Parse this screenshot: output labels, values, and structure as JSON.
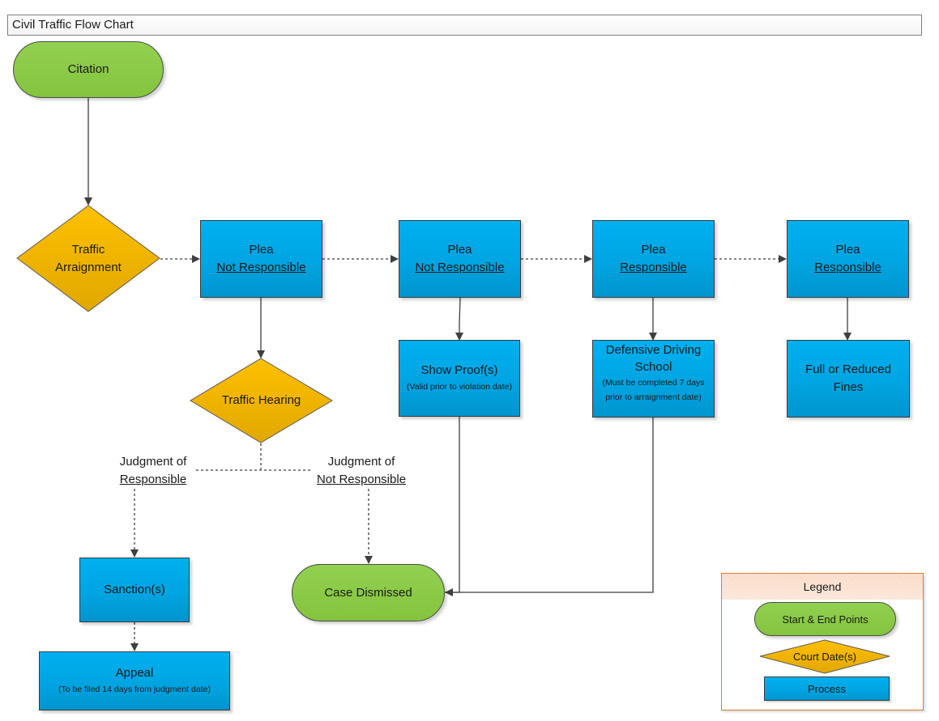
{
  "title": "Civil Traffic Flow Chart",
  "colors": {
    "terminal": "#92d050",
    "decision": "#f5b800",
    "process": "#00b0f0",
    "legend_border": "#e07b39",
    "connector": "#3f3f3f"
  },
  "nodes": {
    "citation": {
      "label": "Citation",
      "type": "terminal"
    },
    "traffic_arraignment": {
      "line1": "Traffic",
      "line2": "Arraignment",
      "type": "decision"
    },
    "plea1": {
      "line1": "Plea",
      "line2": "Not Responsible",
      "type": "process"
    },
    "plea2": {
      "line1": "Plea",
      "line2": "Not Responsible",
      "type": "process"
    },
    "plea3": {
      "line1": "Plea",
      "line2": "Responsible",
      "type": "process"
    },
    "plea4": {
      "line1": "Plea",
      "line2": "Responsible",
      "type": "process"
    },
    "traffic_hearing": {
      "label": "Traffic Hearing",
      "type": "decision"
    },
    "show_proof": {
      "label": "Show Proof(s)",
      "note": "(Valid prior to violation date)",
      "type": "process"
    },
    "defensive_driving": {
      "label": "Defensive Driving School",
      "note": "(Must be completed 7 days prior to arraignment date)",
      "type": "process"
    },
    "fines": {
      "label": "Full or Reduced Fines",
      "type": "process"
    },
    "sanctions": {
      "label": "Sanction(s)",
      "type": "process"
    },
    "appeal": {
      "label": "Appeal",
      "note": "(To be filed 14 days from judgment date)",
      "type": "process"
    },
    "case_dismissed": {
      "label": "Case Dismissed",
      "type": "terminal"
    }
  },
  "judgments": {
    "responsible": {
      "line1": "Judgment of",
      "line2": "Responsible"
    },
    "not_responsible": {
      "line1": "Judgment of",
      "line2": "Not Responsible"
    }
  },
  "edges": [
    {
      "from": "citation",
      "to": "traffic_arraignment",
      "style": "solid"
    },
    {
      "from": "traffic_arraignment",
      "to": "plea1",
      "style": "dotted"
    },
    {
      "from": "plea1",
      "to": "plea2",
      "style": "dotted"
    },
    {
      "from": "plea2",
      "to": "plea3",
      "style": "dotted"
    },
    {
      "from": "plea3",
      "to": "plea4",
      "style": "dotted"
    },
    {
      "from": "plea1",
      "to": "traffic_hearing",
      "style": "solid"
    },
    {
      "from": "plea2",
      "to": "show_proof",
      "style": "solid"
    },
    {
      "from": "plea3",
      "to": "defensive_driving",
      "style": "solid"
    },
    {
      "from": "plea4",
      "to": "fines",
      "style": "solid"
    },
    {
      "from": "traffic_hearing",
      "to": "sanctions",
      "style": "dotted",
      "label": "Judgment of Responsible"
    },
    {
      "from": "traffic_hearing",
      "to": "case_dismissed",
      "style": "dotted",
      "label": "Judgment of Not Responsible"
    },
    {
      "from": "sanctions",
      "to": "appeal",
      "style": "dotted"
    },
    {
      "from": "show_proof",
      "to": "case_dismissed",
      "style": "solid"
    },
    {
      "from": "defensive_driving",
      "to": "case_dismissed",
      "style": "solid"
    }
  ],
  "legend": {
    "title": "Legend",
    "items": [
      {
        "label": "Start & End Points",
        "shape": "terminal"
      },
      {
        "label": "Court Date(s)",
        "shape": "decision"
      },
      {
        "label": "Process",
        "shape": "process"
      }
    ]
  }
}
